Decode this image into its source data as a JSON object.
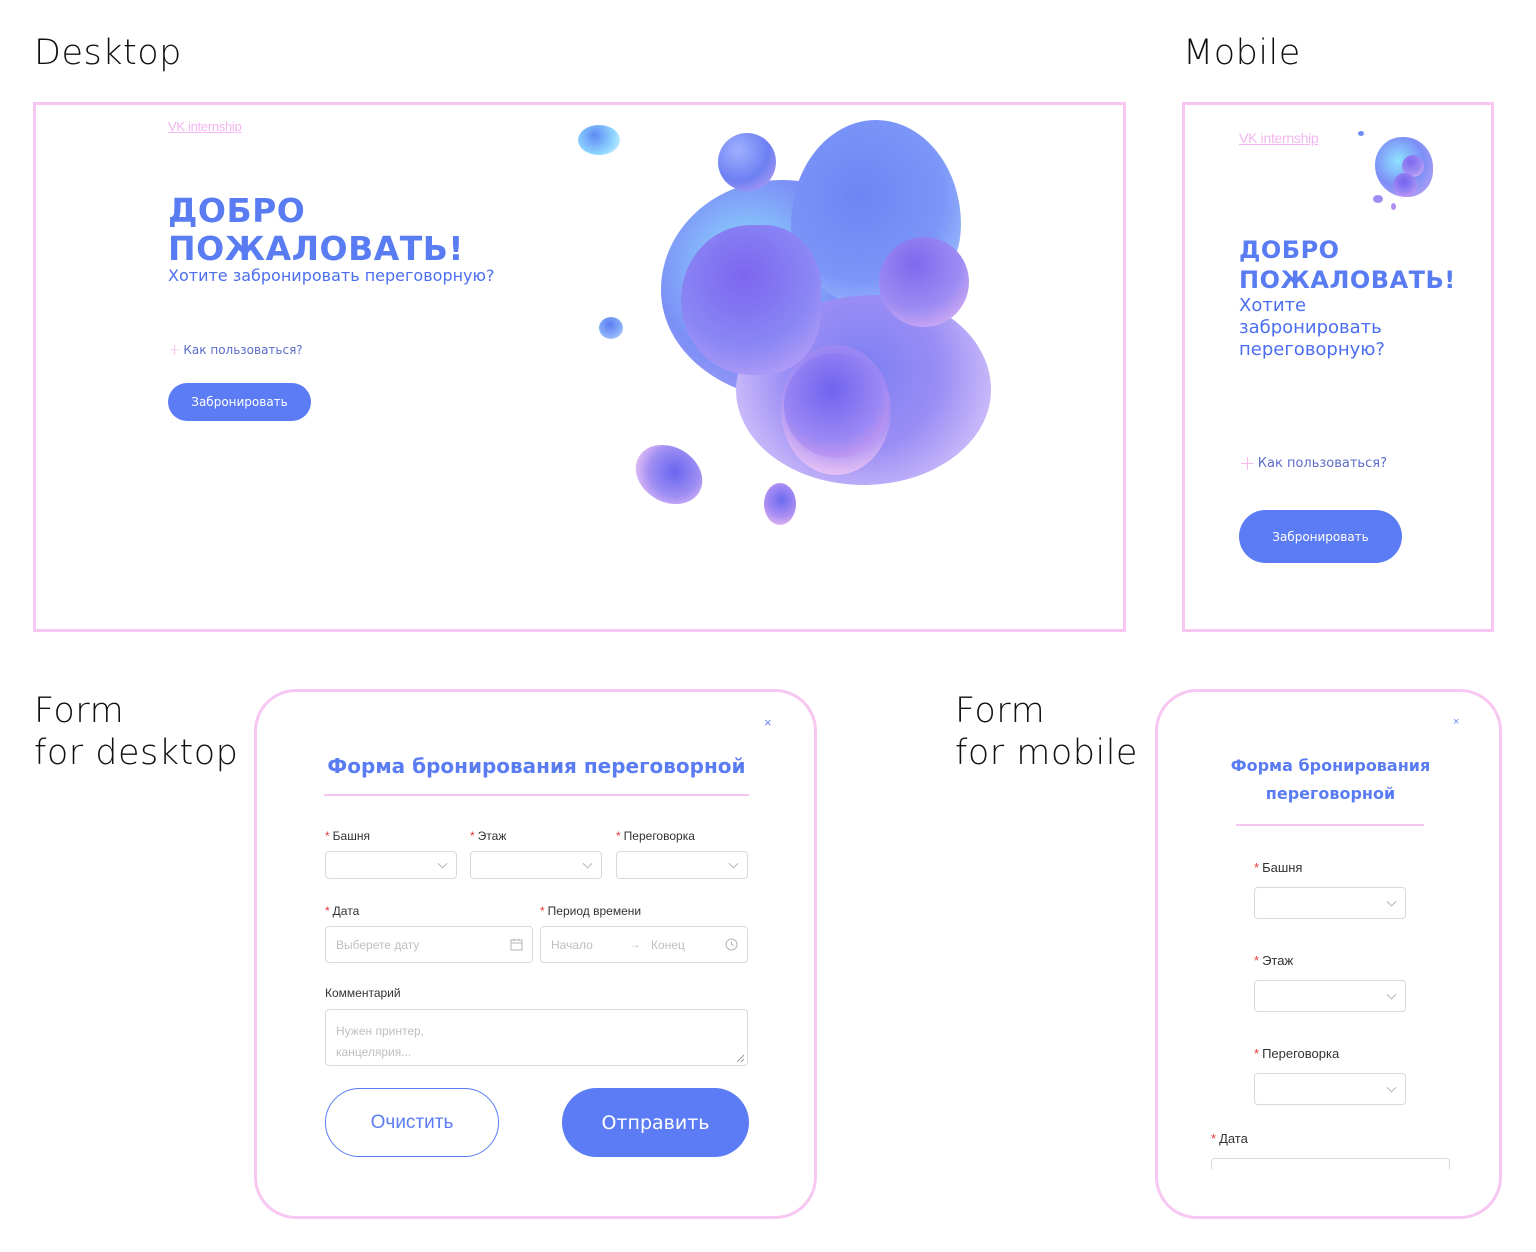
{
  "sections": {
    "desktop": "Desktop",
    "mobile": "Mobile",
    "form_desktop_line1": "Form",
    "form_desktop_line2": "for desktop",
    "form_mobile_line1": "Form",
    "form_mobile_line2": "for mobile"
  },
  "landing": {
    "brand": "VK internship",
    "title_line1": "ДОБРО",
    "title_line2": "ПОЖАЛОВАТЬ!",
    "subtitle": "Хотите забронировать переговорную?",
    "mobile_subtitle_line1": "Хотите",
    "mobile_subtitle_line2": "забронировать",
    "mobile_subtitle_line3": "переговорную?",
    "howto": "Как пользоваться?",
    "book_button": "Забронировать"
  },
  "form": {
    "close": "×",
    "title": "Форма бронирования переговорной",
    "mobile_title_line1": "Форма бронирования",
    "mobile_title_line2": "переговорной",
    "tower_label": "Башня",
    "floor_label": "Этаж",
    "room_label": "Переговорка",
    "date_label": "Дата",
    "date_placeholder": "Выберете дату",
    "period_label": "Период времени",
    "start_placeholder": "Начало",
    "arrow": "→",
    "end_placeholder": "Конец",
    "comment_label": "Комментарий",
    "comment_placeholder_line1": "Нужен принтер,",
    "comment_placeholder_line2": "канцелярия...",
    "required_mark": "*",
    "clear_button": "Очистить",
    "submit_button": "Отправить"
  },
  "colors": {
    "accent": "#5b7cf4",
    "frame_border": "#f7c7f2",
    "required": "#e5393b"
  },
  "icons": [
    "plus-icon",
    "chevron-down-icon",
    "calendar-icon",
    "clock-icon",
    "close-icon",
    "arrow-right-icon"
  ]
}
